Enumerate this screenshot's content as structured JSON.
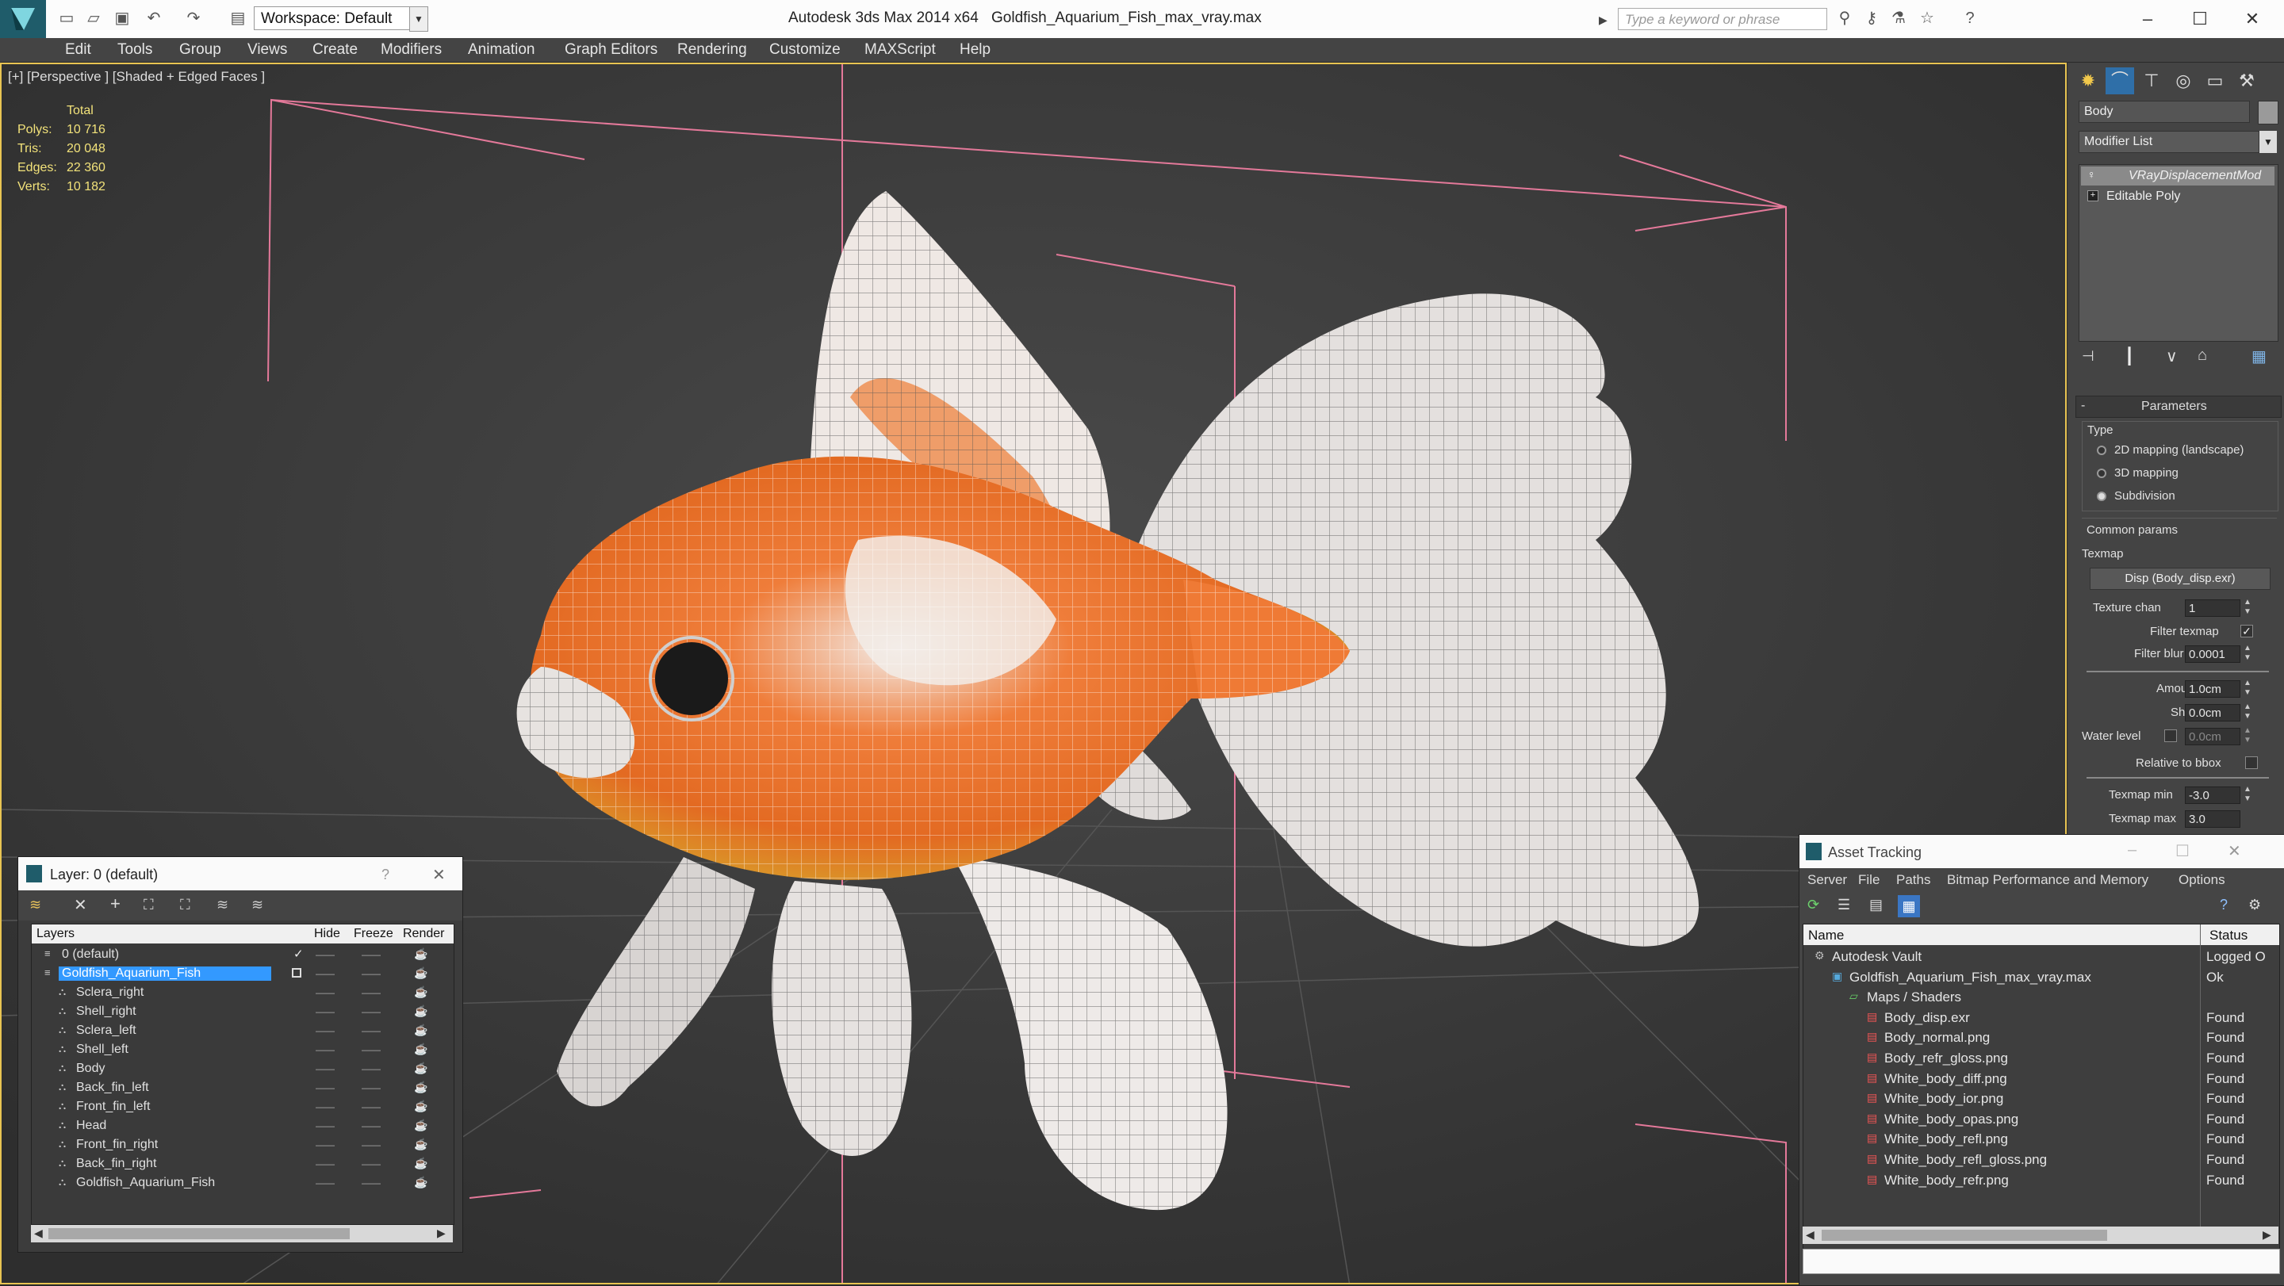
{
  "titlebar": {
    "app_title": "Autodesk 3ds Max  2014 x64",
    "file_title": "Goldfish_Aquarium_Fish_max_vray.max",
    "workspace": "Workspace: Default",
    "search_placeholder": "Type a keyword or phrase"
  },
  "menu": [
    "Edit",
    "Tools",
    "Group",
    "Views",
    "Create",
    "Modifiers",
    "Animation",
    "Graph Editors",
    "Rendering",
    "Customize",
    "MAXScript",
    "Help"
  ],
  "viewport": {
    "label": "[+] [Perspective ] [Shaded + Edged Faces ]",
    "stats": {
      "header": "Total",
      "rows": [
        {
          "label": "Polys:",
          "value": "10 716"
        },
        {
          "label": "Tris:",
          "value": "20 048"
        },
        {
          "label": "Edges:",
          "value": "22 360"
        },
        {
          "label": "Verts:",
          "value": "10 182"
        }
      ]
    }
  },
  "command_panel": {
    "object_name": "Body",
    "modifier_list": "Modifier List",
    "stack": [
      "VRayDisplacementMod",
      "Editable Poly"
    ],
    "rollout_title": "Parameters",
    "type_label": "Type",
    "type_options": [
      {
        "label": "2D mapping (landscape)",
        "selected": false
      },
      {
        "label": "3D mapping",
        "selected": false
      },
      {
        "label": "Subdivision",
        "selected": true
      }
    ],
    "common_params": "Common params",
    "texmap_label": "Texmap",
    "texmap_value": "Disp (Body_disp.exr)",
    "texture_chan_label": "Texture chan",
    "texture_chan_value": "1",
    "filter_texmap_label": "Filter texmap",
    "filter_blur_label": "Filter blur",
    "filter_blur_value": "0.0001",
    "amount_label": "Amount",
    "amount_value": "1.0cm",
    "shift_label": "Shift",
    "shift_value": "0.0cm",
    "water_level_label": "Water level",
    "water_level_value": "0.0cm",
    "relative_bbox_label": "Relative to bbox",
    "texmap_min_label": "Texmap min",
    "texmap_min_value": "-3.0",
    "texmap_max_label": "Texmap max",
    "texmap_max_value": "3.0"
  },
  "layer_panel": {
    "title": "Layer: 0 (default)",
    "help": "?",
    "columns": [
      "Layers",
      "Hide",
      "Freeze",
      "Render"
    ],
    "rows": [
      {
        "name": "0 (default)",
        "level": 1,
        "selected": false
      },
      {
        "name": "Goldfish_Aquarium_Fish",
        "level": 1,
        "selected": true
      },
      {
        "name": "Sclera_right",
        "level": 2,
        "selected": false
      },
      {
        "name": "Shell_right",
        "level": 2,
        "selected": false
      },
      {
        "name": "Sclera_left",
        "level": 2,
        "selected": false
      },
      {
        "name": "Shell_left",
        "level": 2,
        "selected": false
      },
      {
        "name": "Body",
        "level": 2,
        "selected": false
      },
      {
        "name": "Back_fin_left",
        "level": 2,
        "selected": false
      },
      {
        "name": "Front_fin_left",
        "level": 2,
        "selected": false
      },
      {
        "name": "Head",
        "level": 2,
        "selected": false
      },
      {
        "name": "Front_fin_right",
        "level": 2,
        "selected": false
      },
      {
        "name": "Back_fin_right",
        "level": 2,
        "selected": false
      },
      {
        "name": "Goldfish_Aquarium_Fish",
        "level": 2,
        "selected": false
      }
    ]
  },
  "asset_panel": {
    "title": "Asset Tracking",
    "menu": [
      "Server",
      "File",
      "Paths",
      "Bitmap Performance and Memory",
      "Options"
    ],
    "columns": [
      "Name",
      "Status"
    ],
    "rows": [
      {
        "name": "Autodesk Vault",
        "status": "Logged O",
        "level": 0
      },
      {
        "name": "Goldfish_Aquarium_Fish_max_vray.max",
        "status": "Ok",
        "level": 1
      },
      {
        "name": "Maps / Shaders",
        "status": "",
        "level": 2
      },
      {
        "name": "Body_disp.exr",
        "status": "Found",
        "level": 3
      },
      {
        "name": "Body_normal.png",
        "status": "Found",
        "level": 3
      },
      {
        "name": "Body_refr_gloss.png",
        "status": "Found",
        "level": 3
      },
      {
        "name": "White_body_diff.png",
        "status": "Found",
        "level": 3
      },
      {
        "name": "White_body_ior.png",
        "status": "Found",
        "level": 3
      },
      {
        "name": "White_body_opas.png",
        "status": "Found",
        "level": 3
      },
      {
        "name": "White_body_refl.png",
        "status": "Found",
        "level": 3
      },
      {
        "name": "White_body_refl_gloss.png",
        "status": "Found",
        "level": 3
      },
      {
        "name": "White_body_refr.png",
        "status": "Found",
        "level": 3
      }
    ]
  },
  "colors": {
    "accent": "#3399ff",
    "selection": "#3a6ea5",
    "viewport_border": "#e8c452"
  }
}
